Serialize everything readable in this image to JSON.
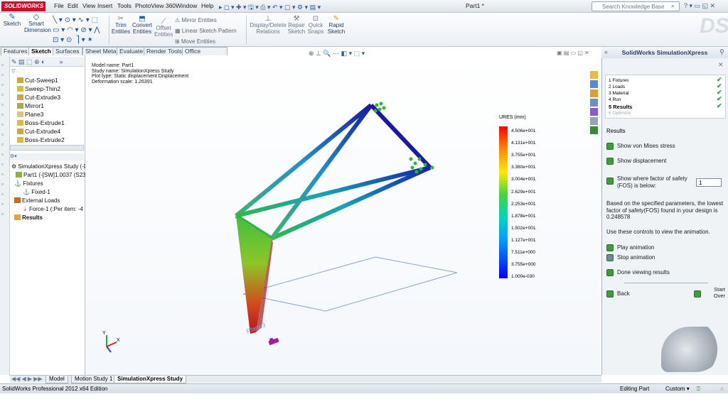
{
  "app": {
    "logo": "SOLIDWORKS",
    "title": "Part1 *"
  },
  "menu": [
    "File",
    "Edit",
    "View",
    "Insert",
    "Tools",
    "PhotoView 360",
    "Window",
    "Help"
  ],
  "search": {
    "placeholder": "Search Knowledge Base"
  },
  "ribbon": {
    "sketch": "Sketch",
    "smart_dimension": "Smart Dimension",
    "trim": "Trim Entities",
    "convert": "Convert Entities",
    "offset": "Offset Entities",
    "mirror": "Mirror Entities",
    "linear_pattern": "Linear Sketch Pattern",
    "move": "Move Entities",
    "display_delete": "Display/Delete Relations",
    "repair": "Repair Sketch",
    "quick_snaps": "Quick Snaps",
    "rapid": "Rapid Sketch"
  },
  "tabs": [
    "Features",
    "Sketch",
    "Surfaces",
    "Sheet Metal",
    "Evaluate",
    "Render Tools",
    "Office Products"
  ],
  "active_tab": "Sketch",
  "tree": [
    "Cut-Sweep1",
    "Sweep-Thin2",
    "Cut-Extrude3",
    "Mirror1",
    "Plane3",
    "Boss-Extrude1",
    "Cut-Extrude4",
    "Boss-Extrude2"
  ],
  "sim_tree": {
    "study": "SimulationXpress Study (-D",
    "part": "Part1 (-[SW]1.0037 (S23",
    "fixtures": "Fixtures",
    "fixed": "Fixed-1",
    "external_loads": "External Loads",
    "force": "Force-1 (:Per item: -4",
    "results": "Results"
  },
  "viewport": {
    "model_name": "Model name: Part1",
    "study_name": "Study name: SimulationXpress Study",
    "plot_type": "Plot type: Static displacement Displacement",
    "deformation": "Deformation scale: 1.26391",
    "plane_label": "Plane3"
  },
  "legend": {
    "title": "URES (mm)",
    "values": [
      "4.506e+001",
      "4.131e+001",
      "3.755e+001",
      "3.380e+001",
      "3.004e+001",
      "2.629e+001",
      "2.253e+001",
      "1.878e+001",
      "1.502e+001",
      "1.127e+001",
      "7.511e+000",
      "3.755e+000",
      "1.000e-030"
    ]
  },
  "task_pane": {
    "title": "SolidWorks SimulationXpress",
    "steps": [
      {
        "n": "1",
        "label": "Fixtures",
        "done": true
      },
      {
        "n": "2",
        "label": "Loads",
        "done": true
      },
      {
        "n": "3",
        "label": "Material",
        "done": true
      },
      {
        "n": "4",
        "label": "Run",
        "done": true
      },
      {
        "n": "5",
        "label": "Results",
        "done": true
      },
      {
        "n": "6",
        "label": "Optimize",
        "done": false
      }
    ],
    "results_heading": "Results",
    "show_vm": "Show von Mises stress",
    "show_disp": "Show displacement",
    "show_fos": "Show where factor of safety (FOS) is below:",
    "fos_value": "1",
    "fos_text": "Based on the specified parameters, the lowest factor of safety(FOS) found in your design is 0.248578",
    "anim_text": "Use these controls to view the animation.",
    "play": "Play animation",
    "stop": "Stop animation",
    "done": "Done viewing results",
    "back": "Back",
    "start_over": "Start Over"
  },
  "bottom_tabs": [
    "Model",
    "Motion Study 1",
    "SimulationXpress Study"
  ],
  "status": {
    "left": "SolidWorks Professional 2012 x64 Edition",
    "mode": "Editing Part",
    "custom": "Custom"
  }
}
